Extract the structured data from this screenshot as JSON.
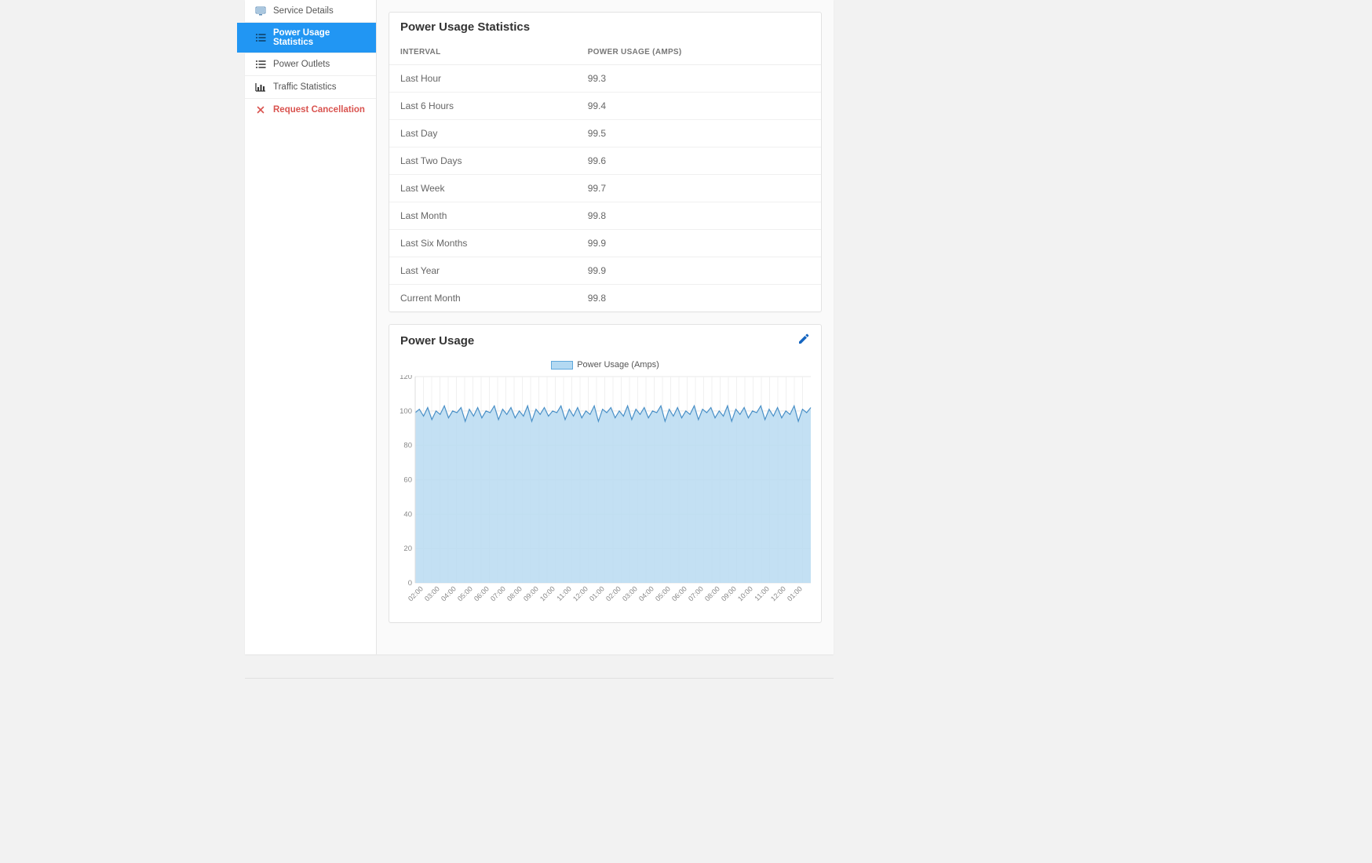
{
  "sidebar": {
    "items": [
      {
        "label": "Service Details",
        "icon": "monitor"
      },
      {
        "label": "Power Usage Statistics",
        "icon": "list",
        "active": true
      },
      {
        "label": "Power Outlets",
        "icon": "list"
      },
      {
        "label": "Traffic Statistics",
        "icon": "chart"
      },
      {
        "label": "Request Cancellation",
        "icon": "close",
        "danger": true
      }
    ]
  },
  "stats": {
    "title": "Power Usage Statistics",
    "headers": {
      "interval": "INTERVAL",
      "usage": "POWER USAGE (AMPS)"
    },
    "rows": [
      {
        "interval": "Last Hour",
        "usage": "99.3"
      },
      {
        "interval": "Last 6 Hours",
        "usage": "99.4"
      },
      {
        "interval": "Last Day",
        "usage": "99.5"
      },
      {
        "interval": "Last Two Days",
        "usage": "99.6"
      },
      {
        "interval": "Last Week",
        "usage": "99.7"
      },
      {
        "interval": "Last Month",
        "usage": "99.8"
      },
      {
        "interval": "Last Six Months",
        "usage": "99.9"
      },
      {
        "interval": "Last Year",
        "usage": "99.9"
      },
      {
        "interval": "Current Month",
        "usage": "99.8"
      }
    ]
  },
  "chart_card": {
    "title": "Power Usage",
    "legend": "Power Usage (Amps)"
  },
  "chart_data": {
    "type": "area",
    "title": "Power Usage",
    "xlabel": "",
    "ylabel": "",
    "ylim": [
      0,
      120
    ],
    "yticks": [
      0,
      20,
      40,
      60,
      80,
      100,
      120
    ],
    "x_ticks": [
      "02:00",
      "03:00",
      "04:00",
      "05:00",
      "06:00",
      "07:00",
      "08:00",
      "09:00",
      "10:00",
      "11:00",
      "12:00",
      "01:00",
      "02:00",
      "03:00",
      "04:00",
      "05:00",
      "06:00",
      "07:00",
      "08:00",
      "09:00",
      "10:00",
      "11:00",
      "12:00",
      "01:00"
    ],
    "series": [
      {
        "name": "Power Usage (Amps)",
        "values": [
          99,
          101,
          97,
          102,
          95,
          100,
          98,
          103,
          96,
          100,
          99,
          102,
          94,
          101,
          97,
          102,
          96,
          100,
          99,
          103,
          95,
          101,
          98,
          102,
          96,
          100,
          97,
          103,
          94,
          101,
          98,
          102,
          97,
          100,
          99,
          103,
          95,
          101,
          97,
          102,
          96,
          100,
          98,
          103,
          94,
          101,
          99,
          102,
          96,
          100,
          97,
          103,
          95,
          101,
          98,
          102,
          96,
          100,
          99,
          103,
          94,
          101,
          97,
          102,
          96,
          100,
          98,
          103,
          95,
          101,
          99,
          102,
          96,
          100,
          97,
          103,
          94,
          101,
          98,
          102,
          96,
          100,
          99,
          103,
          95,
          101,
          97,
          102,
          96,
          100,
          98,
          103,
          94,
          101,
          99,
          102
        ]
      }
    ]
  }
}
